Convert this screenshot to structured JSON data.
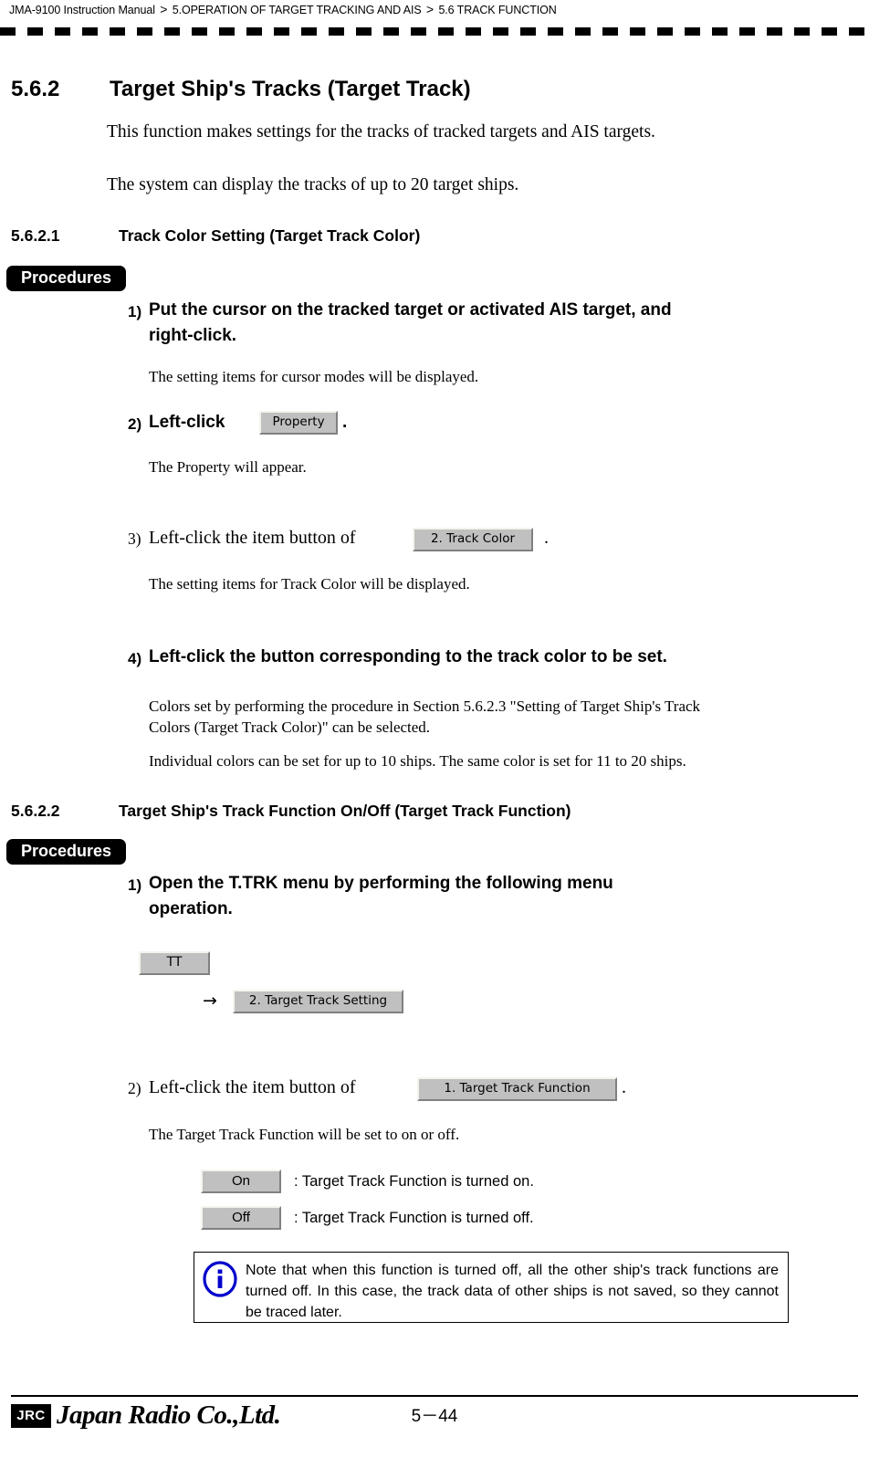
{
  "header": {
    "manual": "JMA-9100 Instruction Manual",
    "sep": ">",
    "chapter": "5.OPERATION OF TARGET TRACKING AND AIS",
    "section": "5.6  TRACK FUNCTION"
  },
  "section_562": {
    "number": "5.6.2",
    "title": "Target Ship's Tracks (Target Track)",
    "intro_1": "This function makes settings for the tracks of tracked targets and AIS targets.",
    "intro_2": "The system can display the tracks of up to 20 target ships."
  },
  "section_5621": {
    "number": "5.6.2.1",
    "title": "Track Color Setting (Target Track Color)",
    "procedures_label": "Procedures",
    "steps": [
      {
        "num": "1)",
        "text_line1": "Put the cursor on the tracked target or activated AIS target, and",
        "text_line2": "right-click.",
        "result": "The setting items for cursor modes will be displayed."
      },
      {
        "num": "2)",
        "lead": "Left-click",
        "button": "Property",
        "trail": ".",
        "result": "The Property will appear."
      },
      {
        "num": "3)",
        "lead": "Left-click the item button of",
        "button": "2. Track Color",
        "trail": ".",
        "result": "The setting items for Track Color will be displayed."
      },
      {
        "num": "4)",
        "text_line1": "Left-click the button corresponding to the track color to be set.",
        "result_line1": "Colors set by performing the procedure in Section 5.6.2.3 \"Setting of Target Ship's Track",
        "result_line2": "Colors (Target Track Color)\" can be selected.",
        "result_line3": "Individual colors can be set for up to 10 ships. The same color is set for 11 to 20 ships."
      }
    ]
  },
  "section_5622": {
    "number": "5.6.2.2",
    "title": "Target Ship's Track Function On/Off (Target Track Function)",
    "procedures_label": "Procedures",
    "step1": {
      "num": "1)",
      "text_line1": "Open the T.TRK menu by performing the following menu",
      "text_line2": "operation.",
      "menu_button_1": "TT",
      "arrow": "→",
      "menu_button_2": "2. Target Track Setting"
    },
    "step2": {
      "num": "2)",
      "lead": "Left-click the item button of",
      "button": "1. Target Track Function",
      "trail": ".",
      "result": "The Target Track Function will be set to on or off."
    },
    "toggle_rows": [
      {
        "button": "On",
        "desc": ": Target Track Function is turned on."
      },
      {
        "button": "Off",
        "desc": ": Target Track Function is turned off."
      }
    ],
    "note": {
      "icon": "info-icon",
      "icon_color": "#0000cc",
      "text": "Note that when this function is turned off, all the other ship's track functions are turned off. In this case, the track data of other ships is not saved, so they cannot be traced later."
    }
  },
  "footer": {
    "logo_text": "JRC",
    "company": "Japan Radio Co.,Ltd.",
    "page": "5－44"
  }
}
